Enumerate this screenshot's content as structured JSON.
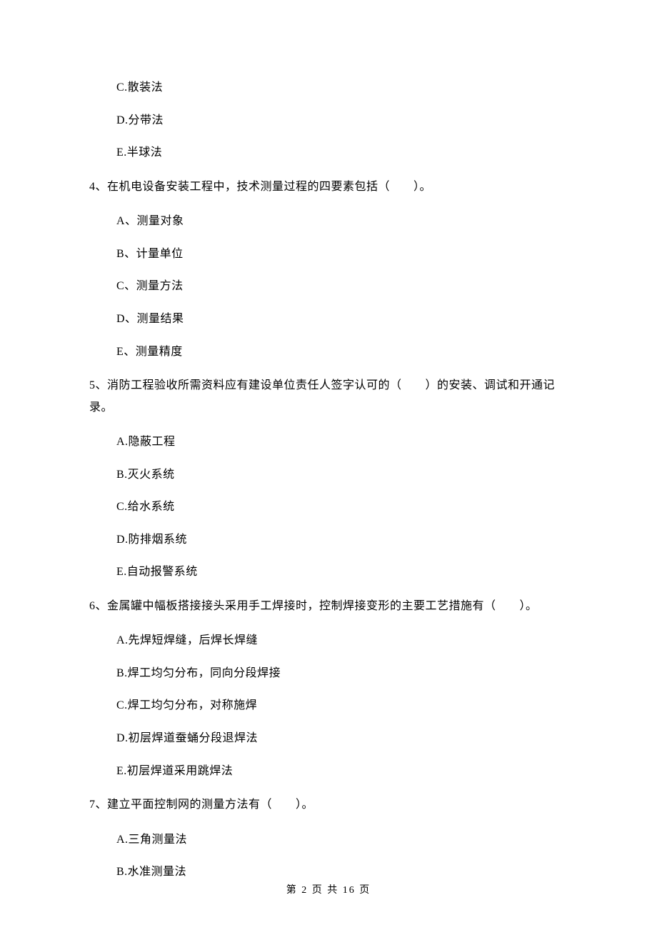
{
  "options_top": [
    "C.散装法",
    "D.分带法",
    "E.半球法"
  ],
  "q4": {
    "text": "4、在机电设备安装工程中，技术测量过程的四要素包括（　　）。",
    "options": [
      "A、测量对象",
      "B、计量单位",
      "C、测量方法",
      "D、测量结果",
      "E、测量精度"
    ]
  },
  "q5": {
    "text": "5、消防工程验收所需资料应有建设单位责任人签字认可的（　　）的安装、调试和开通记录。",
    "options": [
      "A.隐蔽工程",
      "B.灭火系统",
      "C.给水系统",
      "D.防排烟系统",
      "E.自动报警系统"
    ]
  },
  "q6": {
    "text": "6、金属罐中幅板搭接接头采用手工焊接时，控制焊接变形的主要工艺措施有（　　）。",
    "options": [
      "A.先焊短焊缝，后焊长焊缝",
      "B.焊工均匀分布，同向分段焊接",
      "C.焊工均匀分布，对称施焊",
      "D.初层焊道蚕蛹分段退焊法",
      "E.初层焊道采用跳焊法"
    ]
  },
  "q7": {
    "text": "7、建立平面控制网的测量方法有（　　）。",
    "options": [
      "A.三角测量法",
      "B.水准测量法"
    ]
  },
  "footer": "第 2 页 共 16 页"
}
